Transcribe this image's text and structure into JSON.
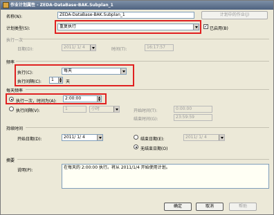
{
  "window": {
    "title": "作业计划属性 - ZEDA-DataBase-BAK.Subplan_1"
  },
  "name": {
    "label": "名称(N):",
    "value": "ZEDA-DataBase-BAK.Subplan_1",
    "jobs_button": "计划中的作业(J)"
  },
  "schedule_type": {
    "label": "计划类型(S):",
    "value": "重复执行",
    "enabled_label": "已启用(B)",
    "enabled": true
  },
  "one_time": {
    "header": "执行一次",
    "date_label": "日期(D):",
    "date_value": "2011/ 1/ 4",
    "time_label": "时间(T):",
    "time_value": "16:17:57"
  },
  "frequency": {
    "header": "频率",
    "occurs_label": "执行(C):",
    "occurs_value": "每天",
    "recurs_label": "执行间隔(C):",
    "recurs_value": "1",
    "recurs_unit": "天"
  },
  "daily_frequency": {
    "header": "每天频率",
    "once_label": "执行一次，时间为(A):",
    "once_value": "2:00:00",
    "every_label": "执行间隔(V):",
    "every_value": "1",
    "every_unit": "小时",
    "start_label": "开始时间(T):",
    "start_value": "0:00:00",
    "end_label": "结束时间(G):",
    "end_value": "23:59:59"
  },
  "duration": {
    "header": "持续时间",
    "start_date_label": "开始日期(D):",
    "start_date_value": "2011/ 1/ 4",
    "end_date_label": "结束日期(E):",
    "end_date_value": "2011/ 1/ 4",
    "no_end_label": "无结束日期(O)"
  },
  "summary": {
    "header": "摘要",
    "desc_label": "说明(P):",
    "desc_value": "在每天的 2:00:00 执行。将从 2011/1/4 开始使用计划。"
  },
  "buttons": {
    "ok": "确定",
    "cancel": "取消",
    "help": "帮助"
  }
}
